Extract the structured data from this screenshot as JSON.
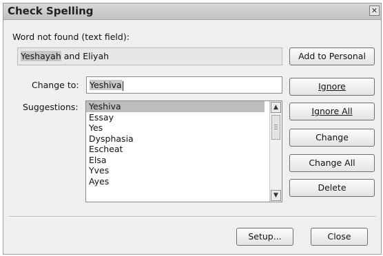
{
  "window": {
    "title": "Check Spelling",
    "close_symbol": "✕"
  },
  "word_not_found": {
    "label": "Word not found (text field):",
    "highlight": "Yeshayah",
    "rest": " and Eliyah"
  },
  "change_to": {
    "label": "Change to:",
    "value": "Yeshiva"
  },
  "suggestions": {
    "label": "Suggestions:",
    "items": [
      "Yeshiva",
      "Essay",
      "Yes",
      "Dysphasia",
      "Escheat",
      "Elsa",
      "Yves",
      "Ayes"
    ],
    "selected_index": 0
  },
  "buttons": {
    "add_to_personal": "Add to Personal",
    "ignore": "Ignore",
    "ignore_all": "Ignore All",
    "change": "Change",
    "change_all": "Change All",
    "delete": "Delete",
    "setup": "Setup...",
    "close": "Close"
  },
  "icons": {
    "scroll_up": "▲",
    "scroll_down": "▼"
  }
}
